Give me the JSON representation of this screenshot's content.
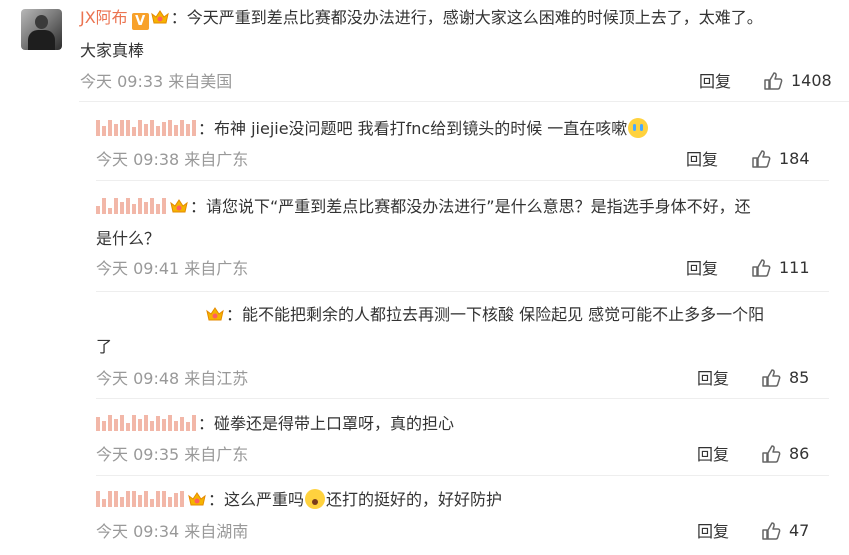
{
  "main_comment": {
    "author": "JX阿布",
    "text_line1": "：今天严重到差点比赛都没办法进行，感谢大家这么困难的时候顶上去了，太难了。",
    "text_line2": "大家真棒",
    "time": "今天 09:33 来自美国",
    "reply_label": "回复",
    "likes": "1408",
    "badge": "V"
  },
  "replies": [
    {
      "text": "：布神 jiejie没问题吧 我看打fnc给到镜头的时候 一直在咳嗽",
      "time": "今天 09:38 来自广东",
      "reply_label": "回复",
      "likes": "184",
      "emoji": "crying-emoji"
    },
    {
      "text_line1": "：请您说下“严重到差点比赛都没办法进行”是什么意思？是指选手身体不好，还",
      "text_line2": "是什么？",
      "time": "今天 09:41 来自广东",
      "reply_label": "回复",
      "likes": "111"
    },
    {
      "text_line1": "：能不能把剩余的人都拉去再测一下核酸 保险起见 感觉可能不止多多一个阳",
      "text_line2": "了",
      "time": "今天 09:48 来自江苏",
      "reply_label": "回复",
      "likes": "85"
    },
    {
      "text": "：碰拳还是得带上口罩呀，真的担心",
      "time": "今天 09:35 来自广东",
      "reply_label": "回复",
      "likes": "86"
    },
    {
      "text_a": "：这么严重吗",
      "text_b": "还打的挺好的，好好防护",
      "time": "今天 09:34 来自湖南",
      "reply_label": "回复",
      "likes": "47",
      "emoji": "scared-emoji"
    }
  ],
  "colors": {
    "nickname": "#eb7350",
    "meta": "#999999",
    "text": "#333333",
    "badge": "#f8a12a",
    "emoji": "#ffd23e"
  }
}
